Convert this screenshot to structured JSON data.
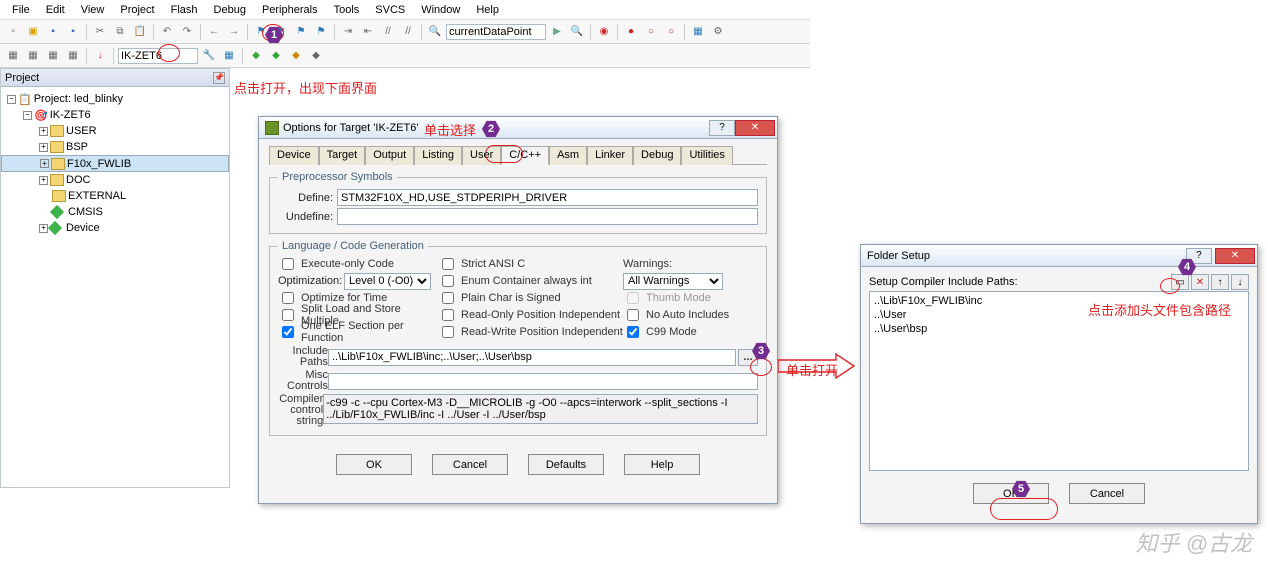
{
  "menu": [
    "File",
    "Edit",
    "View",
    "Project",
    "Flash",
    "Debug",
    "Peripherals",
    "Tools",
    "SVCS",
    "Window",
    "Help"
  ],
  "toolbar": {
    "find_placeholder": "currentDataPoint",
    "target_value": "IK-ZET6"
  },
  "project_panel": {
    "title": "Project",
    "root": "Project: led_blinky",
    "target": "IK-ZET6",
    "folders": [
      "USER",
      "BSP",
      "F10x_FWLIB",
      "DOC",
      "EXTERNAL"
    ],
    "cmsis": "CMSIS",
    "device": "Device"
  },
  "annot": {
    "open_note": "点击打开，出现下面界面",
    "select_note": "单击选择",
    "open2_note": "单击打开",
    "add_note": "点击添加头文件包含路径"
  },
  "dlg": {
    "title": "Options for Target 'IK-ZET6'",
    "tabs": [
      "Device",
      "Target",
      "Output",
      "Listing",
      "User",
      "C/C++",
      "Asm",
      "Linker",
      "Debug",
      "Utilities"
    ],
    "pre_legend": "Preprocessor Symbols",
    "define_lbl": "Define:",
    "define_val": "STM32F10X_HD,USE_STDPERIPH_DRIVER",
    "undefine_lbl": "Undefine:",
    "undefine_val": "",
    "lang_legend": "Language / Code Generation",
    "exec_only": "Execute-only Code",
    "opt_lbl": "Optimization:",
    "opt_val": "Level 0 (-O0)",
    "opt_time": "Optimize for Time",
    "split": "Split Load and Store Multiple",
    "one_elf": "One ELF Section per Function",
    "strict": "Strict ANSI C",
    "enum": "Enum Container always int",
    "plain": "Plain Char is Signed",
    "ro_pos": "Read-Only Position Independent",
    "rw_pos": "Read-Write Position Independent",
    "warn_lbl": "Warnings:",
    "warn_val": "All Warnings",
    "thumb": "Thumb Mode",
    "noauto": "No Auto Includes",
    "c99": "C99 Mode",
    "inc_lbl": "Include\nPaths",
    "inc_val": "..\\Lib\\F10x_FWLIB\\inc;..\\User;..\\User\\bsp",
    "misc_lbl": "Misc\nControls",
    "misc_val": "",
    "comp_lbl": "Compiler\ncontrol\nstring",
    "comp_val": "-c99 -c --cpu Cortex-M3 -D__MICROLIB -g -O0 --apcs=interwork --split_sections -I ../Lib/F10x_FWLIB/inc -I ../User -I ../User/bsp",
    "btns": {
      "ok": "OK",
      "cancel": "Cancel",
      "defaults": "Defaults",
      "help": "Help"
    }
  },
  "fs": {
    "title": "Folder Setup",
    "lbl": "Setup Compiler Include Paths:",
    "items": [
      "..\\Lib\\F10x_FWLIB\\inc",
      "..\\User",
      "..\\User\\bsp"
    ],
    "ok": "OK",
    "cancel": "Cancel"
  },
  "watermark": "知乎 @古龙"
}
